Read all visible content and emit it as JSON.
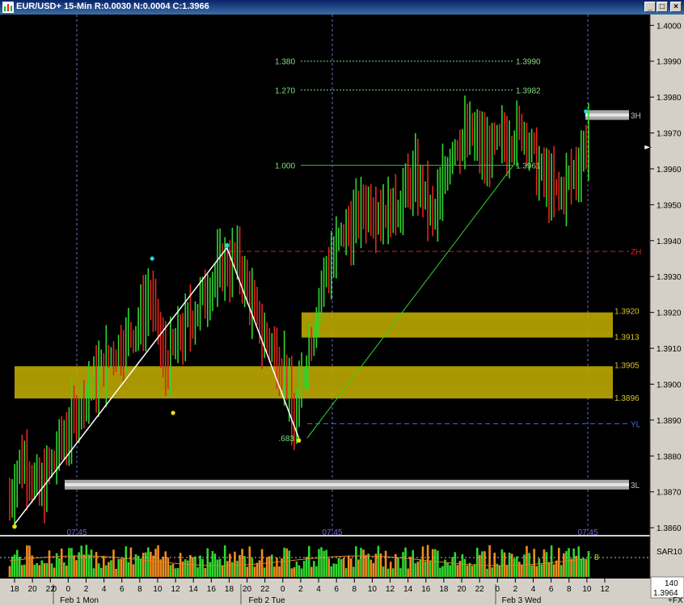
{
  "window": {
    "title": "EUR/USD+ 15-Min R:0.0030 N:0.0004 C:1.3966",
    "minimize_icon": "minimize-icon",
    "maximize_icon": "maximize-icon",
    "close_icon": "close-icon",
    "minimize_glyph": "_",
    "maximize_glyph": "□",
    "close_glyph": "×"
  },
  "colors": {
    "background": "#000000",
    "up_bar": "#2fd62f",
    "down_bar": "#e0281e",
    "zone_fill": "#c8b400",
    "fib_text": "#7fe07f",
    "zone_text": "#d8c820",
    "zh_line": "#d02020",
    "yl_line": "#3a6cff",
    "session_line": "#6a6ad8"
  },
  "chart_data": {
    "type": "candlestick",
    "price_axis": {
      "ticks": [
        "1.4000",
        "1.3990",
        "1.3980",
        "1.3970",
        "1.3960",
        "1.3950",
        "1.3940",
        "1.3930",
        "1.3920",
        "1.3910",
        "1.3900",
        "1.3890",
        "1.3880",
        "1.3870",
        "1.3860"
      ],
      "ylim": [
        1.3858,
        1.4003
      ],
      "current_price_marker": "1.3966"
    },
    "time_axis": {
      "ticks": [
        "18",
        "20",
        "22",
        "0",
        "2",
        "4",
        "6",
        "8",
        "10",
        "12",
        "14",
        "16",
        "18",
        "20",
        "22",
        "0",
        "2",
        "4",
        "6",
        "8",
        "10",
        "12",
        "14",
        "16",
        "18",
        "20",
        "22",
        "0",
        "2",
        "4",
        "6",
        "8",
        "10",
        "12"
      ],
      "first_tick_overlap": "0",
      "dates": [
        "Feb 1 Mon",
        "Feb 2 Tue",
        "Feb 3 Wed"
      ],
      "corner_label": "+FX"
    },
    "session_markers": [
      {
        "label": "07:45"
      },
      {
        "label": "07:45"
      },
      {
        "label": "07:45"
      }
    ],
    "fibonacci": [
      {
        "ratio": "1.380",
        "price": "1.3990",
        "value": 1.399
      },
      {
        "ratio": "1.270",
        "price": "1.3982",
        "value": 1.3982
      },
      {
        "ratio": "1.000",
        "price": "1.3961",
        "value": 1.3961
      }
    ],
    "zigzag_points": [
      {
        "x": 0.0,
        "price": 1.3861,
        "color": "yellow"
      },
      {
        "x": 0.355,
        "price": 1.3938,
        "color": "cyan"
      },
      {
        "x": 0.475,
        "price": 1.3885,
        "color": "yellow",
        "label": ".683"
      }
    ],
    "zones": [
      {
        "top": 1.392,
        "bottom": 1.3913,
        "top_label": "1.3920",
        "bottom_label": "1.3913"
      },
      {
        "top": 1.3905,
        "bottom": 1.3896,
        "top_label": "1.3905",
        "bottom_label": "1.3896"
      }
    ],
    "levels": [
      {
        "label": "3H",
        "price": 1.3975
      },
      {
        "label": "ZH",
        "price": 1.3937
      },
      {
        "label": "YL",
        "price": 1.3889
      },
      {
        "label": "3L",
        "price": 1.3872
      }
    ],
    "swing_dots": [
      {
        "price": 1.3935,
        "color": "cyan"
      },
      {
        "price": 1.3892,
        "color": "yellow"
      },
      {
        "price": 1.3976,
        "color": "cyan"
      }
    ],
    "volume_panel": {
      "indicator": "SAR10",
      "value_label": "8",
      "axis_labels": [
        "140",
        "1.3964"
      ]
    }
  }
}
